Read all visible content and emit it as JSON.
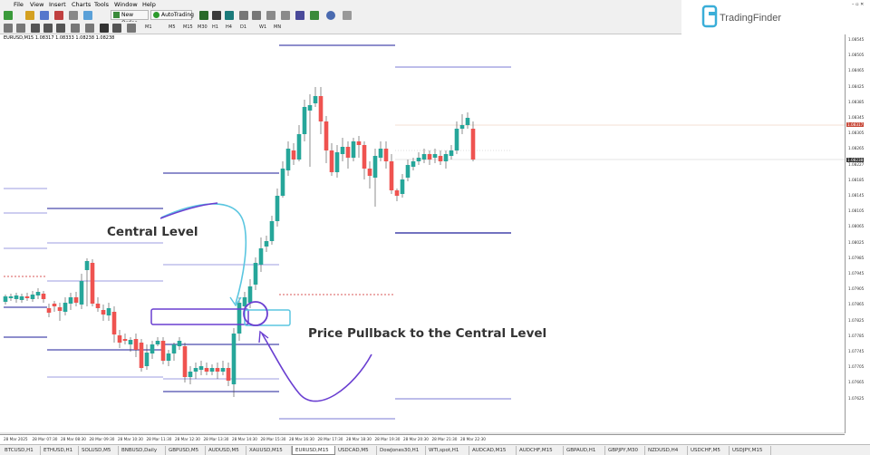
{
  "menu": [
    "File",
    "View",
    "Insert",
    "Charts",
    "Tools",
    "Window",
    "Help"
  ],
  "toolbar": {
    "new_order": "New Order",
    "auto_trading": "AutoTrading"
  },
  "timeframes": [
    "M1",
    "M5",
    "M15",
    "M30",
    "H1",
    "H4",
    "D1",
    "W1",
    "MN"
  ],
  "brand": "TradingFinder",
  "symbol_info": "EURUSD,M15  1.08317 1.08333 1.08238 1.08238",
  "price_labels": [
    "1.08545",
    "1.08505",
    "1.08465",
    "1.08425",
    "1.08385",
    "1.08345",
    "1.08305",
    "1.08265",
    "1.08227",
    "1.08185",
    "1.08145",
    "1.08105",
    "1.08065",
    "1.08025",
    "1.07985",
    "1.07945",
    "1.07905",
    "1.07865",
    "1.07825",
    "1.07785",
    "1.07745",
    "1.07705",
    "1.07665",
    "1.07625"
  ],
  "price_highlight_red": "1.08317",
  "price_highlight_dark": "1.08238",
  "time_labels": [
    "28 Mar 2025",
    "28 Mar 07:30",
    "28 Mar 08:30",
    "28 Mar 09:30",
    "28 Mar 10:30",
    "28 Mar 11:30",
    "28 Mar 12:30",
    "28 Mar 13:30",
    "28 Mar 14:30",
    "28 Mar 15:30",
    "28 Mar 16:30",
    "28 Mar 17:30",
    "28 Mar 18:30",
    "28 Mar 19:30",
    "28 Mar 20:30",
    "28 Mar 21:30",
    "28 Mar 22:30"
  ],
  "annotations": {
    "central": "Central Level",
    "pullback": "Price Pullback to the Central Level"
  },
  "tabs": [
    "BTCUSD,H1",
    "ETHUSD,H1",
    "SOLUSD,M5",
    "BNBUSD,Daily",
    "GBPUSD,M5",
    "AUDUSD,M5",
    "XAUUSD,M15",
    "EURUSD,M15",
    "USDCAD,M5",
    "DowJones30,H1",
    "WTI,spot,H1",
    "AUDCAD,M15",
    "AUDCHF,M15",
    "GBPAUD,H1",
    "GBPJPY,M30",
    "NZDUSD,H4",
    "USDCHF,M5",
    "USDJPY,M15"
  ],
  "active_tab": "EURUSD,M15",
  "colors": {
    "bull": "#26a69a",
    "bear": "#ef5350",
    "level": "#1e1e9a",
    "level_light": "#7b7bd6",
    "purple": "#6a3fd1",
    "cyan": "#5bc6e0",
    "red_dotted": "#cc2222"
  }
}
